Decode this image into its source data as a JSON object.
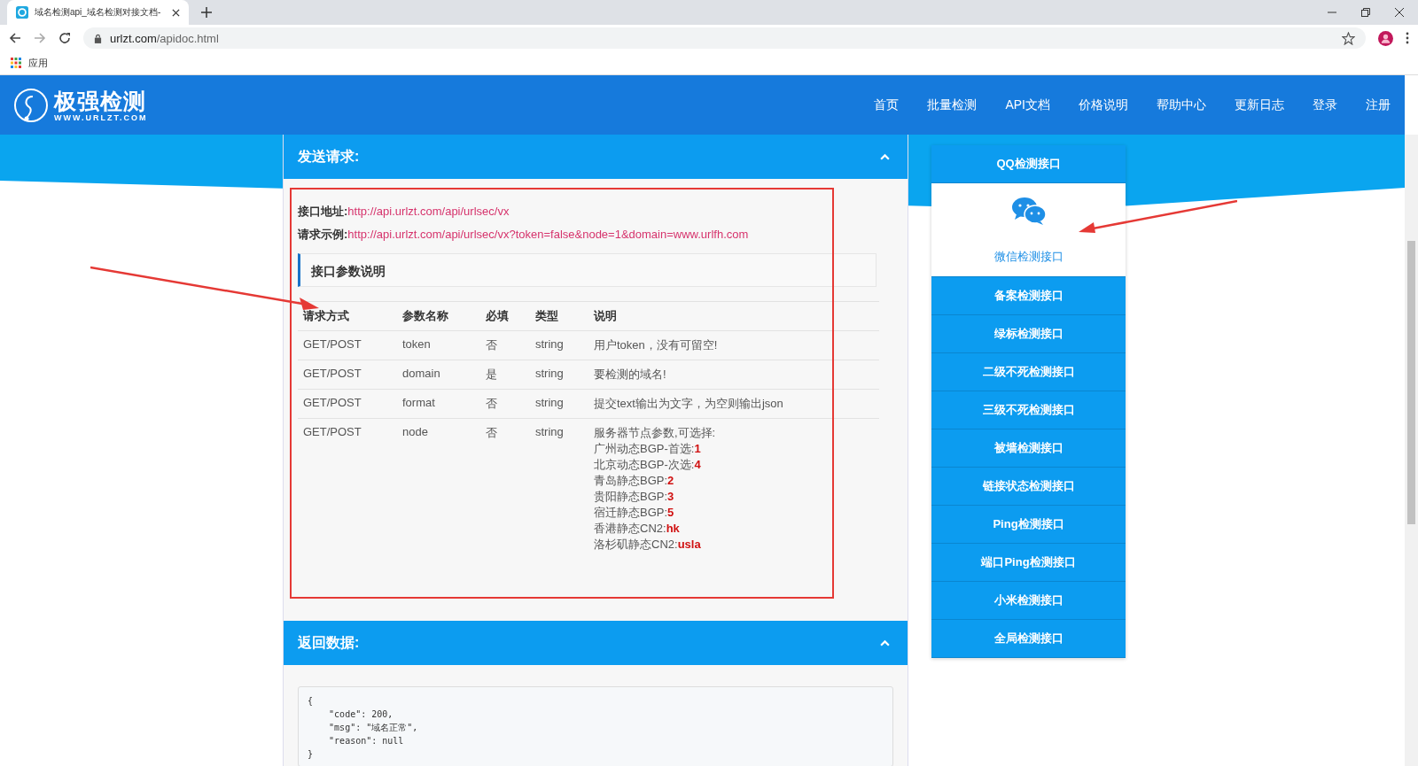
{
  "browser": {
    "tab_title": "域名检测api_域名检测对接文档-",
    "url_host": "urlzt.com",
    "url_path": "/apidoc.html",
    "bookmarks": [
      "应用"
    ]
  },
  "site": {
    "logo_title": "极强检测",
    "logo_subtitle": "WWW.URLZT.COM",
    "nav": [
      {
        "label": "首页"
      },
      {
        "label": "批量检测"
      },
      {
        "label": "API文档"
      },
      {
        "label": "价格说明"
      },
      {
        "label": "帮助中心"
      },
      {
        "label": "更新日志"
      },
      {
        "label": "登录"
      },
      {
        "label": "注册"
      }
    ]
  },
  "request_panel": {
    "title": "发送请求:",
    "expanded": true,
    "fields": [
      {
        "label": "接口地址:",
        "value": "http://api.urlzt.com/api/urlsec/vx"
      },
      {
        "label": "请求示例:",
        "value": "http://api.urlzt.com/api/urlsec/vx?token=false&node=1&domain=www.urlfh.com"
      }
    ],
    "params_heading": "接口参数说明",
    "table": {
      "columns": [
        "请求方式",
        "参数名称",
        "必填",
        "类型",
        "说明"
      ],
      "rows": [
        {
          "method": "GET/POST",
          "name": "token",
          "required": "否",
          "type": "string",
          "description": [
            "用户token，没有可留空!"
          ]
        },
        {
          "method": "GET/POST",
          "name": "domain",
          "required": "是",
          "type": "string",
          "description": [
            "要检测的域名!"
          ]
        },
        {
          "method": "GET/POST",
          "name": "format",
          "required": "否",
          "type": "string",
          "description": [
            "提交text输出为文字，为空则输出json"
          ]
        },
        {
          "method": "GET/POST",
          "name": "node",
          "required": "否",
          "type": "string",
          "description": [
            "服务器节点参数,可选择:",
            "广州动态BGP-首选:**1**",
            "北京动态BGP-次选:**4**",
            "青岛静态BGP:**2**",
            "贵阳静态BGP:**3**",
            "宿迁静态BGP:**5**",
            "香港静态CN2:**hk**",
            "洛杉矶静态CN2:**usla**"
          ]
        }
      ]
    }
  },
  "response_panel": {
    "title": "返回数据:",
    "expanded": true,
    "code": "{\n    \"code\": 200,\n    \"msg\": \"域名正常\",\n    \"reason\": null\n}"
  },
  "sidebar": {
    "items": [
      {
        "label": "QQ检测接口",
        "selected": false
      },
      {
        "label": "微信检测接口",
        "selected": true
      },
      {
        "label": "备案检测接口",
        "selected": false
      },
      {
        "label": "绿标检测接口",
        "selected": false
      },
      {
        "label": "二级不死检测接口",
        "selected": false
      },
      {
        "label": "三级不死检测接口",
        "selected": false
      },
      {
        "label": "被墙检测接口",
        "selected": false
      },
      {
        "label": "链接状态检测接口",
        "selected": false
      },
      {
        "label": "Ping检测接口",
        "selected": false
      },
      {
        "label": "端口Ping检测接口",
        "selected": false
      },
      {
        "label": "小米检测接口",
        "selected": false
      },
      {
        "label": "全局检测接口",
        "selected": false
      }
    ]
  }
}
